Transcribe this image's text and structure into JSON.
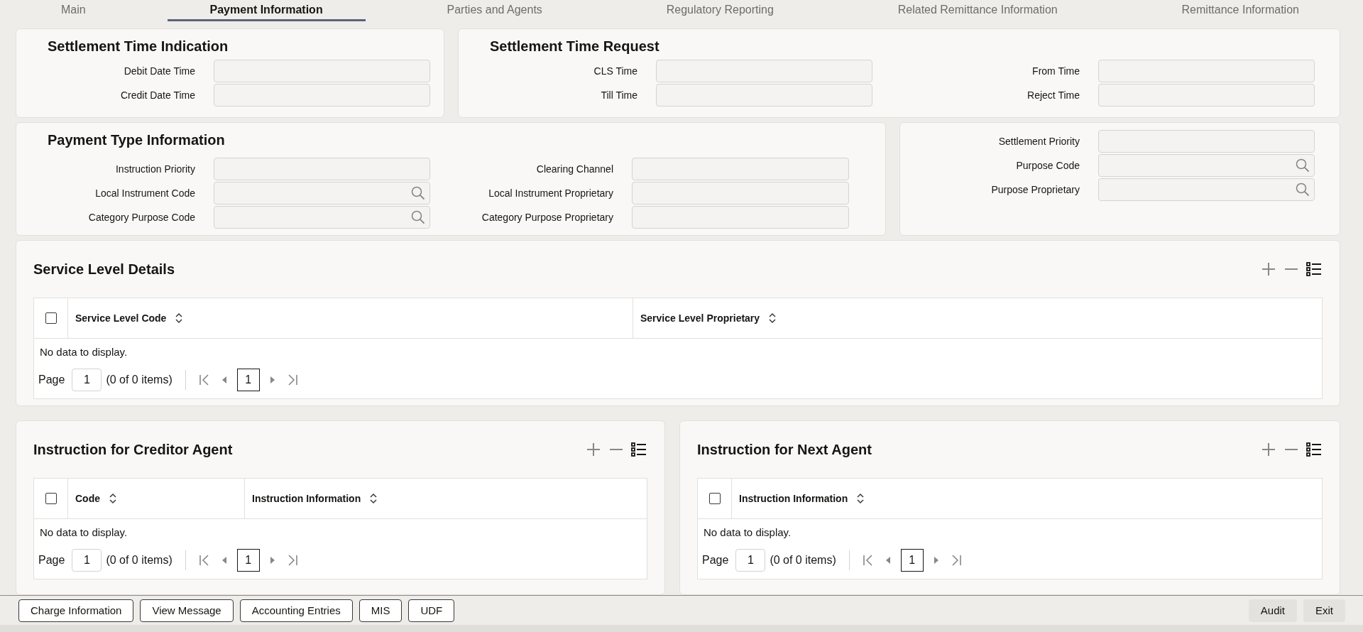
{
  "tabs": [
    {
      "label": "Main",
      "selected": false
    },
    {
      "label": "Payment Information",
      "selected": true
    },
    {
      "label": "Parties and Agents",
      "selected": false
    },
    {
      "label": "Regulatory Reporting",
      "selected": false
    },
    {
      "label": "Related Remittance Information",
      "selected": false
    },
    {
      "label": "Remittance Information",
      "selected": false
    }
  ],
  "settlement_time_indication": {
    "title": "Settlement Time Indication",
    "fields": [
      {
        "label": "Debit Date Time",
        "kind": "text"
      },
      {
        "label": "Credit Date Time",
        "kind": "text"
      }
    ]
  },
  "settlement_time_request": {
    "title": "Settlement Time Request",
    "fields": [
      {
        "label": "CLS Time",
        "kind": "text"
      },
      {
        "label": "From Time",
        "kind": "text"
      },
      {
        "label": "Till Time",
        "kind": "text"
      },
      {
        "label": "Reject Time",
        "kind": "text"
      }
    ]
  },
  "payment_type_information": {
    "title": "Payment Type Information",
    "fields": [
      {
        "label": "Instruction Priority",
        "kind": "text"
      },
      {
        "label": "Clearing Channel",
        "kind": "text"
      },
      {
        "label": "Local Instrument Code",
        "kind": "lookup"
      },
      {
        "label": "Local Instrument Proprietary",
        "kind": "text"
      },
      {
        "label": "Category Purpose Code",
        "kind": "lookup"
      },
      {
        "label": "Category Purpose Proprietary",
        "kind": "text"
      }
    ]
  },
  "purpose": {
    "fields": [
      {
        "label": "Settlement Priority",
        "kind": "text"
      },
      {
        "label": "Purpose Code",
        "kind": "lookup"
      },
      {
        "label": "Purpose Proprietary",
        "kind": "lookup"
      }
    ]
  },
  "service_level_details": {
    "title": "Service Level Details",
    "select_all_checked": false,
    "columns": [
      "Service Level Code",
      "Service Level Proprietary"
    ],
    "empty_message": "No data to display.",
    "pagination": {
      "label": "Page",
      "page_input": "1",
      "summary": "(0 of 0 items)",
      "current_page": "1"
    }
  },
  "instruction_for_creditor_agent": {
    "title": "Instruction for Creditor Agent",
    "select_all_checked": false,
    "columns": [
      "Code",
      "Instruction Information"
    ],
    "empty_message": "No data to display.",
    "pagination": {
      "label": "Page",
      "page_input": "1",
      "summary": "(0 of 0 items)",
      "current_page": "1"
    }
  },
  "instruction_for_next_agent": {
    "title": "Instruction for Next Agent",
    "select_all_checked": false,
    "columns": [
      "Instruction Information"
    ],
    "empty_message": "No data to display.",
    "pagination": {
      "label": "Page",
      "page_input": "1",
      "summary": "(0 of 0 items)",
      "current_page": "1"
    }
  },
  "footer": {
    "left_buttons": [
      "Charge Information",
      "View Message",
      "Accounting Entries",
      "MIS",
      "UDF"
    ],
    "right_buttons": [
      "Audit",
      "Exit"
    ]
  }
}
